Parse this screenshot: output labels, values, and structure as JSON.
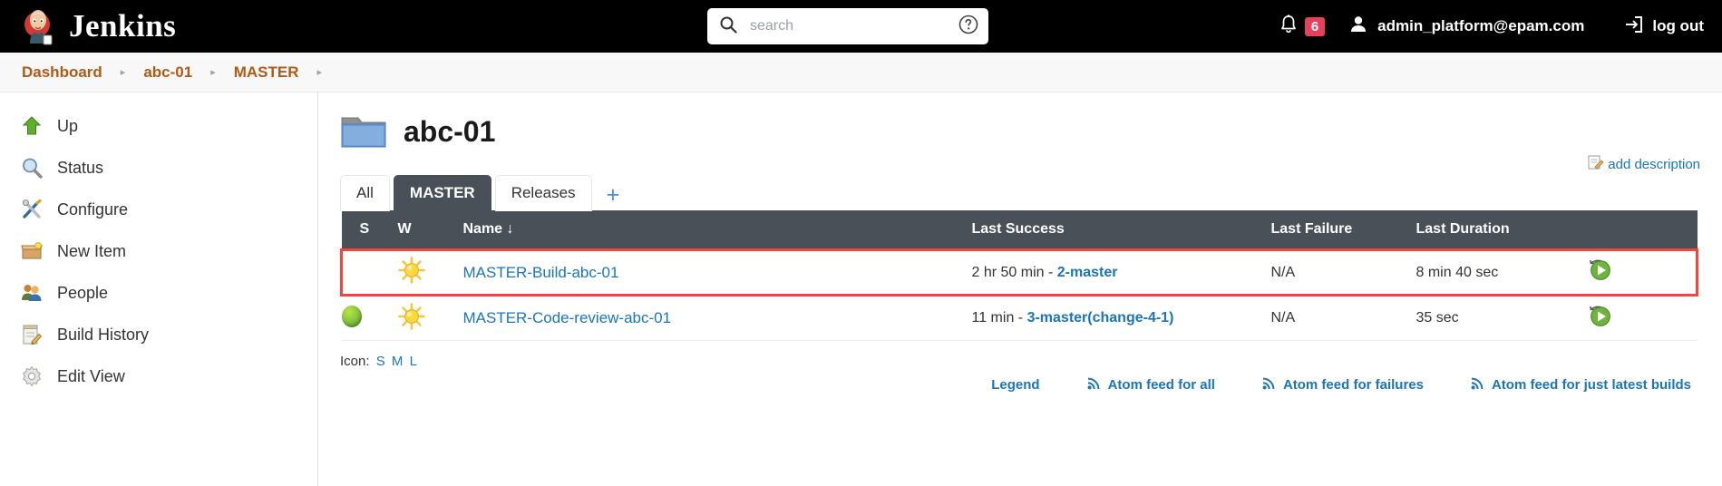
{
  "header": {
    "brand": "Jenkins",
    "brand_icon": "jenkins-butler-logo",
    "search": {
      "placeholder": "search",
      "value": "",
      "icon": "search-icon",
      "help_icon": "help-circle-icon"
    },
    "notifications": {
      "icon": "bell-icon",
      "count": "6"
    },
    "user": {
      "icon": "person-icon",
      "name": "admin_platform@epam.com"
    },
    "logout": {
      "icon": "logout-arrow-icon",
      "label": "log out"
    }
  },
  "breadcrumb": {
    "items": [
      "Dashboard",
      "abc-01",
      "MASTER"
    ],
    "separator": "▸"
  },
  "sidebar": {
    "items": [
      {
        "label": "Up",
        "icon": "up-arrow-icon"
      },
      {
        "label": "Status",
        "icon": "magnifier-icon"
      },
      {
        "label": "Configure",
        "icon": "wrench-screwdriver-icon"
      },
      {
        "label": "New Item",
        "icon": "new-item-box-icon"
      },
      {
        "label": "People",
        "icon": "people-icon"
      },
      {
        "label": "Build History",
        "icon": "notepad-pencil-icon"
      },
      {
        "label": "Edit View",
        "icon": "gear-icon"
      }
    ]
  },
  "page": {
    "title": "abc-01",
    "folder_icon": "folder-icon",
    "add_description": {
      "label": "add description",
      "icon": "edit-description-icon"
    }
  },
  "tabs": {
    "items": [
      {
        "label": "All",
        "active": false
      },
      {
        "label": "MASTER",
        "active": true
      },
      {
        "label": "Releases",
        "active": false
      }
    ],
    "add_label": "+"
  },
  "table": {
    "columns": [
      "S",
      "W",
      "Name  ↓",
      "Last Success",
      "Last Failure",
      "Last Duration",
      ""
    ],
    "rows": [
      {
        "status_icon": "",
        "weather_icon": "sunny-icon",
        "name": "MASTER-Build-abc-01",
        "last_success_time": "2 hr 50 min - ",
        "last_success_build": "2-master",
        "last_failure": "N/A",
        "last_duration": "8 min 40 sec",
        "action_icon": "schedule-build-icon",
        "highlighted": true
      },
      {
        "status_icon": "blue-ball-success-icon",
        "weather_icon": "sunny-icon",
        "name": "MASTER-Code-review-abc-01",
        "last_success_time": "11 min - ",
        "last_success_build": "3-master(change-4-1)",
        "last_failure": "N/A",
        "last_duration": "35 sec",
        "action_icon": "schedule-build-icon",
        "highlighted": false
      }
    ]
  },
  "footer": {
    "icon_label": "Icon:",
    "sizes": [
      "S",
      "M",
      "L"
    ],
    "legend": "Legend",
    "feeds": [
      {
        "label": "Atom feed for all",
        "icon": "rss-icon"
      },
      {
        "label": "Atom feed for failures",
        "icon": "rss-icon"
      },
      {
        "label": "Atom feed for just latest builds",
        "icon": "rss-icon"
      }
    ]
  },
  "colors": {
    "header_bg": "#000000",
    "accent_link": "#1b75bb",
    "breadcrumb_text": "#b05a16",
    "table_header_bg": "#4a5058",
    "badge_red": "#e5405e",
    "highlight_border": "#f4443c"
  }
}
